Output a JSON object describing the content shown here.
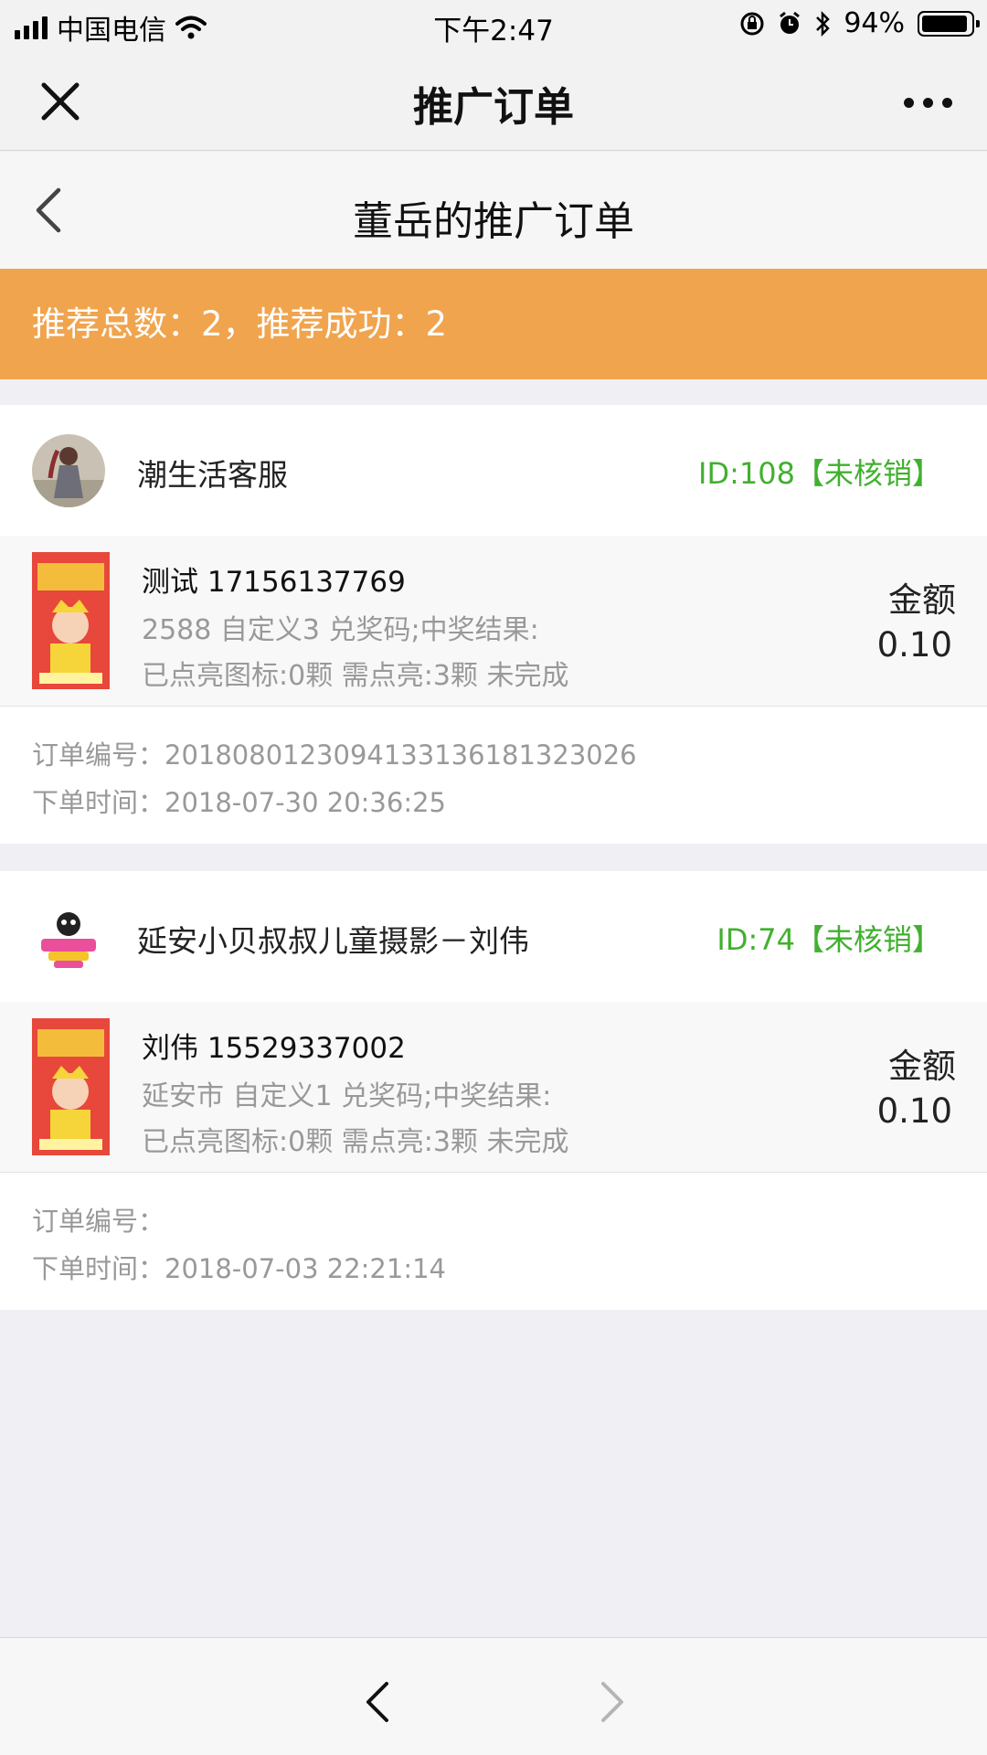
{
  "status_bar": {
    "carrier": "中国电信",
    "time": "下午2:47",
    "battery": "94%",
    "battery_level": 0.94,
    "icons": [
      "signal-icon",
      "wifi-icon",
      "rotation-lock-icon",
      "alarm-icon",
      "bluetooth-icon",
      "battery-icon"
    ]
  },
  "nav": {
    "title": "推广订单",
    "close_icon": "close-icon",
    "more_icon": "more-icon"
  },
  "sub_header": {
    "title": "董岳的推广订单",
    "back_icon": "chevron-left-icon"
  },
  "summary": {
    "text": "推荐总数：2，推荐成功：2",
    "color": "#f0a44e"
  },
  "orders": [
    {
      "shop_name": "潮生活客服",
      "status": "ID:108【未核销】",
      "product_title": "测试 17156137769",
      "line1": "2588 自定义3 兑奖码;中奖结果:",
      "line2": "已点亮图标:0颗 需点亮:3颗 未完成",
      "amount_label": "金额",
      "amount": "0.10",
      "order_no": "订单编号：2018080123094133136181323026",
      "order_time": "下单时间：2018-07-30 20:36:25"
    },
    {
      "shop_name": "延安小贝叔叔儿童摄影－刘伟",
      "status": "ID:74【未核销】",
      "product_title": "刘伟 15529337002",
      "line1": "延安市 自定义1 兑奖码;中奖结果:",
      "line2": "已点亮图标:0颗 需点亮:3颗 未完成",
      "amount_label": "金额",
      "amount": "0.10",
      "order_no": "订单编号：",
      "order_time": "下单时间：2018-07-03 22:21:14"
    }
  ],
  "colors": {
    "status_green": "#41b02f",
    "banner_orange": "#f0a44e",
    "background": "#efeff4"
  },
  "bottom_bar": {
    "back_icon": "chevron-left-icon",
    "forward_icon": "chevron-right-icon"
  }
}
